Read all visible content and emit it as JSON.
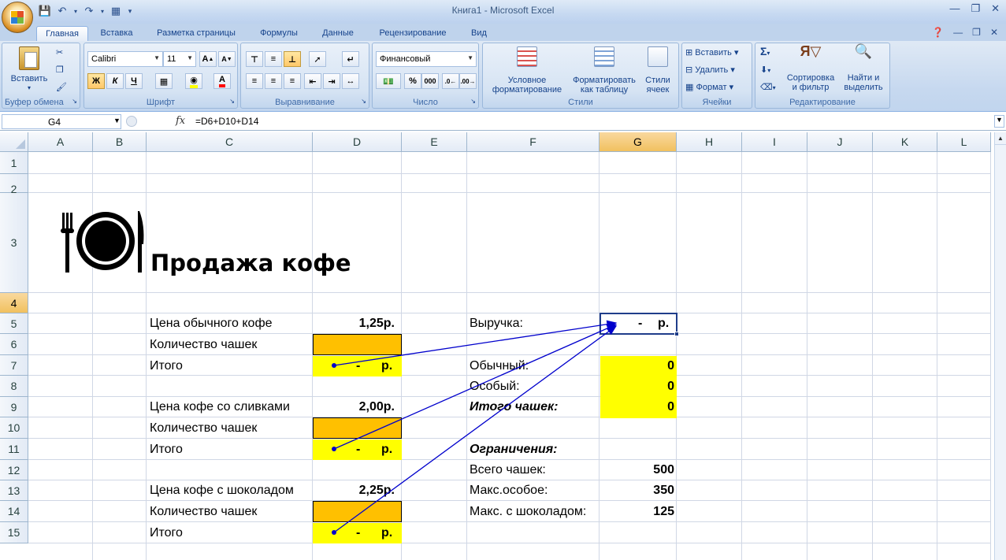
{
  "window": {
    "title": "Книга1 - Microsoft Excel"
  },
  "tabs": [
    "Главная",
    "Вставка",
    "Разметка страницы",
    "Формулы",
    "Данные",
    "Рецензирование",
    "Вид"
  ],
  "ribbon": {
    "clipboard": {
      "paste": "Вставить",
      "label": "Буфер обмена"
    },
    "font": {
      "name": "Calibri",
      "size": "11",
      "bold": "Ж",
      "italic": "К",
      "underline": "Ч",
      "label": "Шрифт"
    },
    "alignment": {
      "label": "Выравнивание"
    },
    "number": {
      "format": "Финансовый",
      "percent": "%",
      "thousands": "000",
      "label": "Число"
    },
    "styles": {
      "conditional1": "Условное",
      "conditional2": "форматирование",
      "table1": "Форматировать",
      "table2": "как таблицу",
      "cell1": "Стили",
      "cell2": "ячеек",
      "label": "Стили"
    },
    "cells": {
      "insert": "Вставить",
      "delete": "Удалить",
      "format": "Формат",
      "label": "Ячейки"
    },
    "editing": {
      "sort1": "Сортировка",
      "sort2": "и фильтр",
      "find1": "Найти и",
      "find2": "выделить",
      "label": "Редактирование"
    }
  },
  "formula_bar": {
    "name_box": "G4",
    "fx": "fx",
    "formula": "=D6+D10+D14"
  },
  "columns": [
    "A",
    "B",
    "C",
    "D",
    "E",
    "F",
    "G",
    "H",
    "I",
    "J",
    "K",
    "L"
  ],
  "rows": [
    "1",
    "2",
    "3",
    "4",
    "5",
    "6",
    "7",
    "8",
    "9",
    "10",
    "11",
    "12",
    "13",
    "14",
    "15"
  ],
  "sheet": {
    "title": "Продажа кофе",
    "c4": "Цена обычного кофе",
    "d4": "1,25р.",
    "c5": "Количество чашек",
    "c6": "Итого",
    "d6_dash": "-",
    "d6_cur": "р.",
    "c8": "Цена кофе со сливками",
    "d8": "2,00р.",
    "c9": "Количество чашек",
    "c10": "Итого",
    "d10_dash": "-",
    "d10_cur": "р.",
    "c12": "Цена кофе с шоколадом",
    "d12": "2,25р.",
    "c13": "Количество чашек",
    "c14": "Итого",
    "d14_dash": "-",
    "d14_cur": "р.",
    "f4": "Выручка:",
    "g4_dash": "-",
    "g4_cur": "р.",
    "f6": "Обычный:",
    "g6": "0",
    "f7": "Особый:",
    "g7": "0",
    "f8": "Итого чашек:",
    "g8": "0",
    "f10": "Ограничения:",
    "f11": "Всего чашек:",
    "g11": "500",
    "f12": "Макс.особое:",
    "g12": "350",
    "f13": "Макс. с шоколадом:",
    "g13": "125"
  },
  "colors": {
    "yellow": "#ffff00",
    "orange": "#ffc000",
    "arrow": "#0000cc",
    "selection": "#1f3d8a"
  }
}
